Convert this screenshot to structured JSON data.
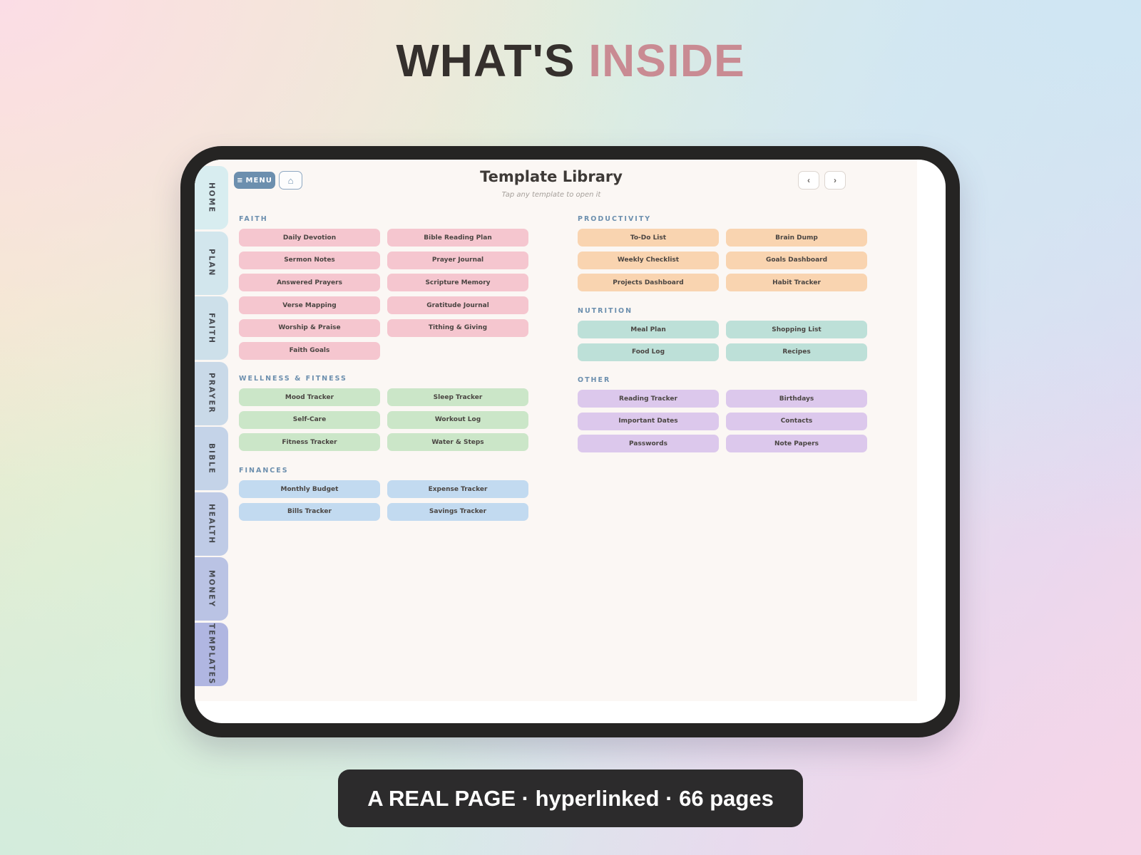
{
  "headline": {
    "part1": "WHAT'S",
    "part2": "INSIDE"
  },
  "colors": {
    "headline_dark": "#35302d",
    "headline_accent": "#c98b93",
    "section_title": "#6c8fae",
    "menu_button": "#6c8fae",
    "faith": "#f5c6cf",
    "wellness": "#cbe6c8",
    "finances": "#c2daf0",
    "productivity": "#f9d4b0",
    "nutrition": "#bde0d8",
    "other": "#dcc8ec"
  },
  "side_tabs": [
    {
      "label": "HOME",
      "color": "#d8edf0"
    },
    {
      "label": "PLAN",
      "color": "#d2e6ed"
    },
    {
      "label": "FAITH",
      "color": "#cde0ea"
    },
    {
      "label": "PRAYER",
      "color": "#c9d9e8"
    },
    {
      "label": "BIBLE",
      "color": "#c4d3e8"
    },
    {
      "label": "HEALTH",
      "color": "#bfcbe6"
    },
    {
      "label": "MONEY",
      "color": "#bac3e4"
    },
    {
      "label": "TEMPLATES",
      "color": "#b0b6e1"
    }
  ],
  "header": {
    "menu_icon": "hamburger-icon",
    "menu_icon_glyph": "≡",
    "menu_label": "MENU",
    "home_icon": "home-icon",
    "home_icon_glyph": "⌂",
    "title": "Template Library",
    "subtitle": "Tap any template to open it",
    "prev_icon": "chevron-left-icon",
    "prev_glyph": "‹",
    "next_icon": "chevron-right-icon",
    "next_glyph": "›"
  },
  "sections": [
    {
      "title": "FAITH",
      "color": "pink",
      "items": [
        "Daily Devotion",
        "Bible Reading Plan",
        "Sermon Notes",
        "Prayer Journal",
        "Answered Prayers",
        "Scripture Memory",
        "Verse Mapping",
        "Gratitude Journal",
        "Worship & Praise",
        "Tithing & Giving",
        "Faith Goals"
      ]
    },
    {
      "title": "WELLNESS & FITNESS",
      "color": "green",
      "items": [
        "Mood Tracker",
        "Sleep Tracker",
        "Self-Care",
        "Workout Log",
        "Fitness Tracker",
        "Water & Steps"
      ]
    },
    {
      "title": "FINANCES",
      "color": "blue",
      "items": [
        "Monthly Budget",
        "Expense Tracker",
        "Bills Tracker",
        "Savings Tracker"
      ]
    },
    {
      "title": "PRODUCTIVITY",
      "color": "orange",
      "items": [
        "To-Do List",
        "Brain Dump",
        "Weekly Checklist",
        "Goals Dashboard",
        "Projects Dashboard",
        "Habit Tracker"
      ]
    },
    {
      "title": "NUTRITION",
      "color": "teal",
      "items": [
        "Meal Plan",
        "Shopping List",
        "Food Log",
        "Recipes"
      ]
    },
    {
      "title": "OTHER",
      "color": "purple",
      "items": [
        "Reading Tracker",
        "Birthdays",
        "Important Dates",
        "Contacts",
        "Passwords",
        "Note Papers"
      ]
    }
  ],
  "caption": "A REAL PAGE · hyperlinked · 66 pages"
}
